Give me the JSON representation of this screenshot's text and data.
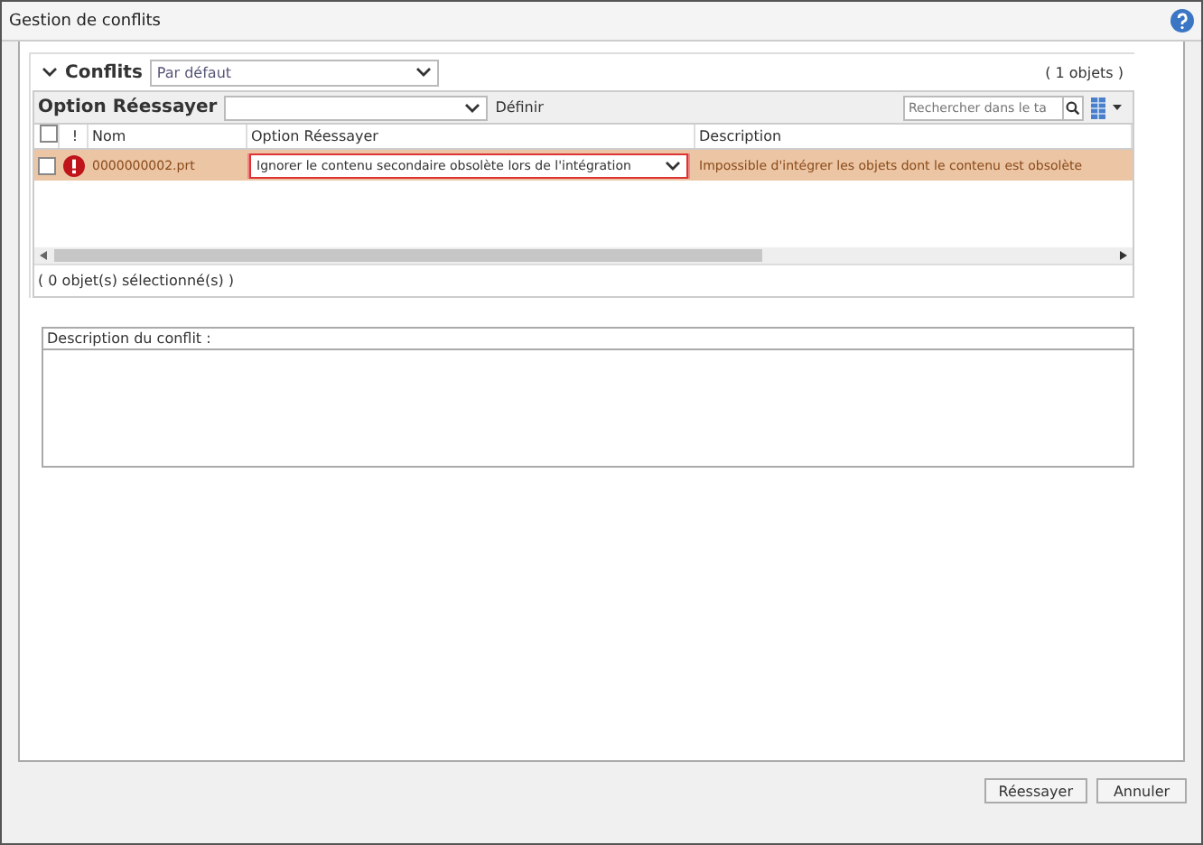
{
  "window": {
    "title": "Gestion de conflits"
  },
  "conflicts": {
    "title": "Conflits",
    "expanded": true,
    "view": "Par défaut",
    "count": "( 1 objets )"
  },
  "toolbar": {
    "label": "Option Réessayer",
    "apply": "Définir",
    "search_placeholder": "Rechercher dans le ta"
  },
  "table": {
    "select_all_checked": false,
    "columns": [
      "!",
      "Nom",
      "Option Réessayer",
      "Description"
    ],
    "rows": [
      {
        "checked": false,
        "selected": true,
        "error": true,
        "name": "0000000002.prt",
        "option": "Ignorer le contenu secondaire obsolète lors de l'intégration",
        "description": "Impossible d'intégrer les objets dont le contenu est obsolète"
      }
    ]
  },
  "selection_status": "( 0 objet(s) sélectionné(s) )",
  "description_box": {
    "label": "Description du conflit :"
  },
  "buttons": [
    "Réessayer",
    "Annuler"
  ]
}
